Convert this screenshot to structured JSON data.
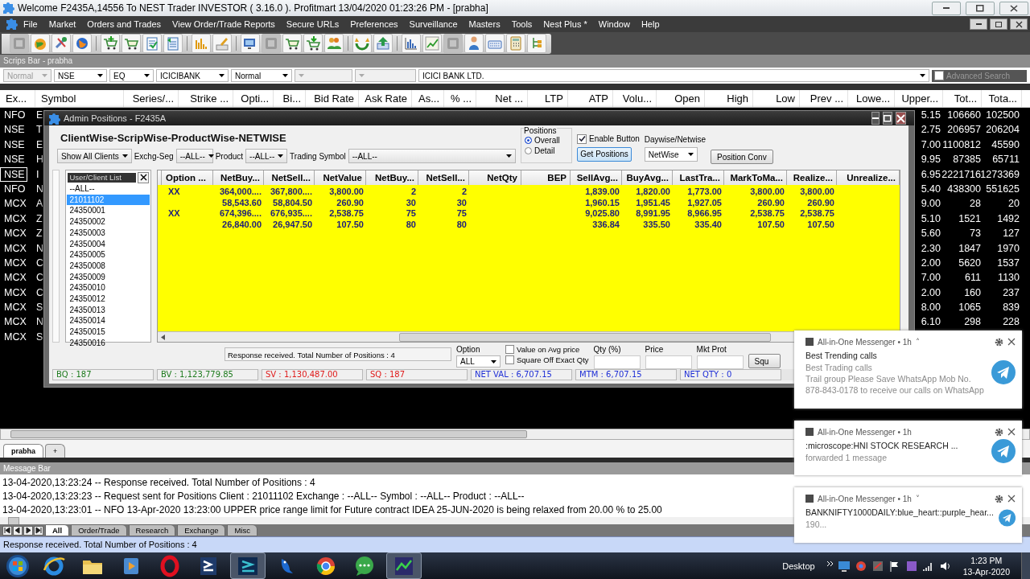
{
  "window": {
    "title": "Welcome F2435A,14556 To NEST Trader INVESTOR ( 3.16.0 ).  Profitmart  13/04/2020  01:23:26 PM - [prabha]"
  },
  "menu": [
    "File",
    "Market",
    "Orders and Trades",
    "View Order/Trade Reports",
    "Secure URLs",
    "Preferences",
    "Surveillance",
    "Masters",
    "Tools",
    "Nest Plus *",
    "Window",
    "Help"
  ],
  "scrips_bar": {
    "title": "Scrips Bar - prabha",
    "fields": [
      {
        "value": "Normal",
        "disabled": true
      },
      {
        "value": "NSE",
        "disabled": false
      },
      {
        "value": "EQ",
        "disabled": false
      },
      {
        "value": "ICICIBANK",
        "disabled": false
      },
      {
        "value": "Normal",
        "disabled": false
      },
      {
        "disabled": true
      },
      {
        "disabled": true
      }
    ],
    "description": "ICICI BANK LTD.",
    "advanced_search": {
      "label": "Advanced Search",
      "checked": false
    }
  },
  "market_watch": {
    "columns": [
      "Ex...",
      "Symbol",
      "Series/...",
      "Strike ...",
      "Opti...",
      "Bi...",
      "Bid Rate",
      "Ask Rate",
      "As...",
      "% ...",
      "Net ...",
      "LTP",
      "ATP",
      "Volu...",
      "Open",
      "High",
      "Low",
      "Prev ...",
      "Lowe...",
      "Upper...",
      "Tot...",
      "Tota..."
    ],
    "rows": [
      {
        "exchange": "NFO",
        "symbol": "E",
        "upper": "5.15",
        "total_1": "106660",
        "total_2": "102500",
        "selected": false
      },
      {
        "exchange": "NSE",
        "symbol": "T",
        "upper": "2.75",
        "total_1": "206957",
        "total_2": "206204",
        "selected": false
      },
      {
        "exchange": "NSE",
        "symbol": "E",
        "upper": "7.00",
        "total_1": "1100812",
        "total_2": "45590",
        "selected": false
      },
      {
        "exchange": "NSE",
        "symbol": "H",
        "upper": "9.95",
        "total_1": "87385",
        "total_2": "65711",
        "selected": false
      },
      {
        "exchange": "NSE",
        "symbol": "I",
        "upper": "6.95",
        "total_1": "2221716",
        "total_2": "1273369",
        "selected": true
      },
      {
        "exchange": "NFO",
        "symbol": "N",
        "upper": "5.40",
        "total_1": "438300",
        "total_2": "551625",
        "selected": false
      },
      {
        "exchange": "MCX",
        "symbol": "A",
        "upper": "9.00",
        "total_1": "28",
        "total_2": "20",
        "selected": false
      },
      {
        "exchange": "MCX",
        "symbol": "Z",
        "upper": "5.10",
        "total_1": "1521",
        "total_2": "1492",
        "selected": false
      },
      {
        "exchange": "MCX",
        "symbol": "Z",
        "upper": "5.60",
        "total_1": "73",
        "total_2": "127",
        "selected": false
      },
      {
        "exchange": "MCX",
        "symbol": "N",
        "upper": "2.30",
        "total_1": "1847",
        "total_2": "1970",
        "selected": false
      },
      {
        "exchange": "MCX",
        "symbol": "C",
        "upper": "2.00",
        "total_1": "5620",
        "total_2": "1537",
        "selected": false
      },
      {
        "exchange": "MCX",
        "symbol": "C",
        "upper": "7.00",
        "total_1": "611",
        "total_2": "1130",
        "selected": false
      },
      {
        "exchange": "MCX",
        "symbol": "C",
        "upper": "2.00",
        "total_1": "160",
        "total_2": "237",
        "selected": false
      },
      {
        "exchange": "MCX",
        "symbol": "S",
        "upper": "8.00",
        "total_1": "1065",
        "total_2": "839",
        "selected": false
      },
      {
        "exchange": "MCX",
        "symbol": "N",
        "upper": "6.10",
        "total_1": "298",
        "total_2": "228",
        "selected": false
      },
      {
        "exchange": "MCX",
        "symbol": "S",
        "selected": false
      }
    ]
  },
  "admin_positions": {
    "title": "Admin Positions - F2435A",
    "heading": "ClientWise-ScripWise-ProductWise-NETWISE",
    "client_filter": "Show All Clients",
    "filters": [
      {
        "label": "Exchg-Seg",
        "value": "--ALL--"
      },
      {
        "label": "Product",
        "value": "--ALL--"
      },
      {
        "label": "Trading Symbol",
        "value": "--ALL--"
      }
    ],
    "positions_group": {
      "title": "Positions",
      "options": [
        {
          "label": "Overall",
          "selected": true
        },
        {
          "label": "Detail",
          "selected": false
        }
      ]
    },
    "enable_button": {
      "label": "Enable Button",
      "checked": true
    },
    "get_positions_button": "Get Positions",
    "daywise_netwise": {
      "label": "Daywise/Netwise",
      "value": "NetWise"
    },
    "position_conv_button": "Position Conv",
    "client_list": {
      "title": "User/Client List",
      "items": [
        {
          "label": "--ALL--",
          "selected": false
        },
        {
          "label": "21011102",
          "selected": true
        },
        {
          "label": "24350001",
          "selected": false
        },
        {
          "label": "24350002",
          "selected": false
        },
        {
          "label": "24350003",
          "selected": false
        },
        {
          "label": "24350004",
          "selected": false
        },
        {
          "label": "24350005",
          "selected": false
        },
        {
          "label": "24350008",
          "selected": false
        },
        {
          "label": "24350009",
          "selected": false
        },
        {
          "label": "24350010",
          "selected": false
        },
        {
          "label": "24350012",
          "selected": false
        },
        {
          "label": "24350013",
          "selected": false
        },
        {
          "label": "24350014",
          "selected": false
        },
        {
          "label": "24350015",
          "selected": false
        },
        {
          "label": "24350016",
          "selected": false
        }
      ]
    },
    "grid": {
      "columns": [
        "Option ...",
        "NetBuy...",
        "NetSell...",
        "NetValue",
        "NetBuy...",
        "NetSell...",
        "NetQty",
        "BEP",
        "SellAvg...",
        "BuyAvg...",
        "LastTra...",
        "MarkToMa...",
        "Realize...",
        "Unrealize..."
      ],
      "rows": [
        {
          "option": "XX",
          "net_buy_value": "364,000....",
          "net_sell_value": "367,800....",
          "net_value": "3,800.00",
          "net_buy_qty": "2",
          "net_sell_qty": "2",
          "sell_avg": "1,839.00",
          "buy_avg": "1,820.00",
          "last_traded": "1,773.00",
          "mtm": "3,800.00",
          "realized": "3,800.00"
        },
        {
          "net_buy_value": "58,543.60",
          "net_sell_value": "58,804.50",
          "net_value": "260.90",
          "net_buy_qty": "30",
          "net_sell_qty": "30",
          "sell_avg": "1,960.15",
          "buy_avg": "1,951.45",
          "last_traded": "1,927.05",
          "mtm": "260.90",
          "realized": "260.90"
        },
        {
          "option": "XX",
          "net_buy_value": "674,396....",
          "net_sell_value": "676,935....",
          "net_value": "2,538.75",
          "net_buy_qty": "75",
          "net_sell_qty": "75",
          "sell_avg": "9,025.80",
          "buy_avg": "8,991.95",
          "last_traded": "8,966.95",
          "mtm": "2,538.75",
          "realized": "2,538.75"
        },
        {
          "net_buy_value": "26,840.00",
          "net_sell_value": "26,947.50",
          "net_value": "107.50",
          "net_buy_qty": "80",
          "net_sell_qty": "80",
          "sell_avg": "336.84",
          "buy_avg": "335.50",
          "last_traded": "335.40",
          "mtm": "107.50",
          "realized": "107.50"
        }
      ]
    },
    "message": "Response received. Total Number of Positions : 4",
    "option": {
      "label": "Option",
      "value": "ALL"
    },
    "checkboxes": [
      {
        "label": "Value on Avg  price",
        "checked": false
      },
      {
        "label": "Square Off Exact Qty",
        "checked": false
      }
    ],
    "inputs": [
      {
        "label": "Qty (%)"
      },
      {
        "label": "Price"
      },
      {
        "label": "Mkt Prot"
      }
    ],
    "square_off_button": "Squ",
    "totals": [
      {
        "text": "BQ : 187",
        "color": "#1e7b1e"
      },
      {
        "text": "BV : 1,123,779.85",
        "color": "#1e7b1e"
      },
      {
        "text": "SV : 1,130,487.00",
        "color": "#e01b1b"
      },
      {
        "text": "SQ : 187",
        "color": "#e01b1b"
      },
      {
        "text": "NET VAL : 6,707.15",
        "color": "#1f2fd6"
      },
      {
        "text": "MTM : 6,707.15",
        "color": "#1f2fd6"
      },
      {
        "text": "NET QTY : 0",
        "color": "#1f2fd6"
      }
    ]
  },
  "workspace_tabs": [
    {
      "label": "prabha",
      "selected": true
    },
    {
      "label": "+",
      "selected": false
    }
  ],
  "message_bar": {
    "title": "Message Bar",
    "messages": [
      "13-04-2020,13:23:24  -- Response received. Total Number of Positions : 4",
      "13-04-2020,13:23:23  -- Request sent for Positions  Client : 21011102 Exchange : --ALL-- Symbol : --ALL-- Product : --ALL--",
      "13-04-2020,13:23:01  -- NFO 13-Apr-2020 13:23:00 UPPER price range limit for Future contract IDEA 25-JUN-2020 is being relaxed from 20.00 % to 25.00"
    ],
    "tabs": [
      {
        "label": "All",
        "selected": true
      },
      {
        "label": "Order/Trade",
        "selected": false
      },
      {
        "label": "Research",
        "selected": false
      },
      {
        "label": "Exchange",
        "selected": false
      },
      {
        "label": "Misc",
        "selected": false
      }
    ]
  },
  "status_bar": "Response received. Total Number of Positions : 4",
  "taskbar": {
    "desktop_label": "Desktop",
    "time": "1:23 PM",
    "date": "13-Apr-2020"
  },
  "notifications": [
    {
      "app": "All-in-One Messenger • 1h",
      "expand_arrow": "˄",
      "title": "Best Trending calls",
      "lines": [
        "Best Trading calls",
        "Trail group Please Save WhatsApp Mob No.",
        "878-843-0178 to receive our calls on WhatsApp"
      ]
    },
    {
      "app": "All-in-One Messenger • 1h",
      "title": ":microscope:HNI STOCK RESEARCH ...",
      "lines": [
        "forwarded 1 message"
      ]
    },
    {
      "app": "All-in-One Messenger • 1h",
      "expand_arrow": "˅",
      "title": "BANKNIFTY1000DAILY:blue_heart::purple_hear...",
      "lines": [
        "190..."
      ]
    }
  ]
}
